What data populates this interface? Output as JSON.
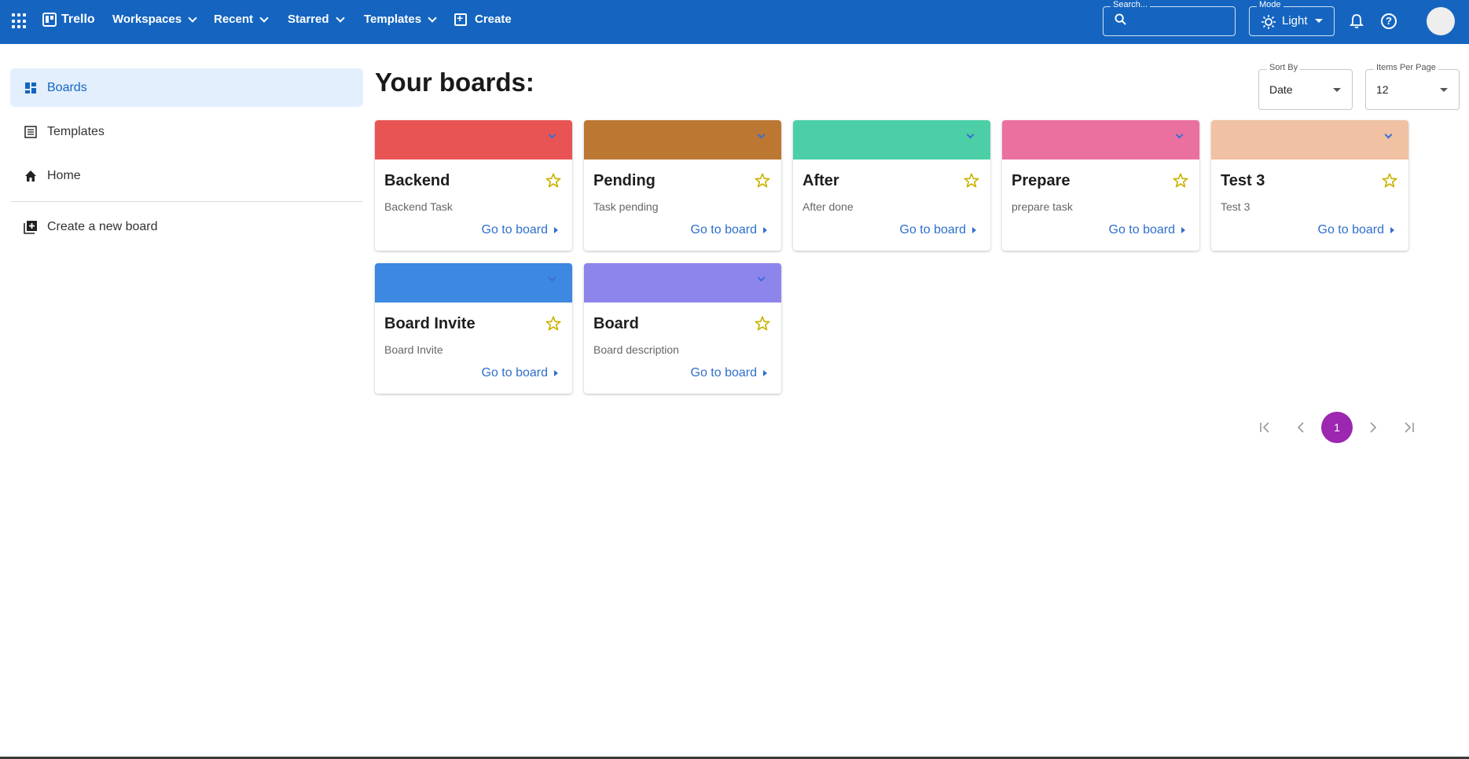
{
  "header": {
    "brand": "Trello",
    "nav": [
      {
        "label": "Workspaces"
      },
      {
        "label": "Recent"
      },
      {
        "label": "Starred"
      },
      {
        "label": "Templates"
      }
    ],
    "create_label": "Create",
    "search_label": "Search...",
    "mode_label": "Mode",
    "mode_value": "Light",
    "colors": {
      "bar": "#1565c0"
    }
  },
  "sidebar": {
    "items": [
      {
        "label": "Boards",
        "icon": "dashboard-icon"
      },
      {
        "label": "Templates",
        "icon": "list-icon"
      },
      {
        "label": "Home",
        "icon": "home-icon"
      }
    ],
    "create_board_label": "Create a new board"
  },
  "main": {
    "title": "Your boards:",
    "sort_label": "Sort By",
    "sort_value": "Date",
    "per_page_label": "Items Per Page",
    "per_page_value": "12",
    "link_label": "Go to board",
    "boards": [
      {
        "title": "Backend",
        "description": "Backend Task",
        "color": "#e85454"
      },
      {
        "title": "Pending",
        "description": "Task pending",
        "color": "#bc7733"
      },
      {
        "title": "After",
        "description": "After done",
        "color": "#4ccfa6"
      },
      {
        "title": "Prepare",
        "description": "prepare task",
        "color": "#ea70a0"
      },
      {
        "title": "Test 3",
        "description": "Test 3",
        "color": "#f0c1a2"
      },
      {
        "title": "Board Invite",
        "description": "Board Invite",
        "color": "#3d88e0"
      },
      {
        "title": "Board",
        "description": "Board description",
        "color": "#8e85ec"
      }
    ],
    "pagination": {
      "current": "1",
      "accent": "#9c27b0"
    }
  }
}
